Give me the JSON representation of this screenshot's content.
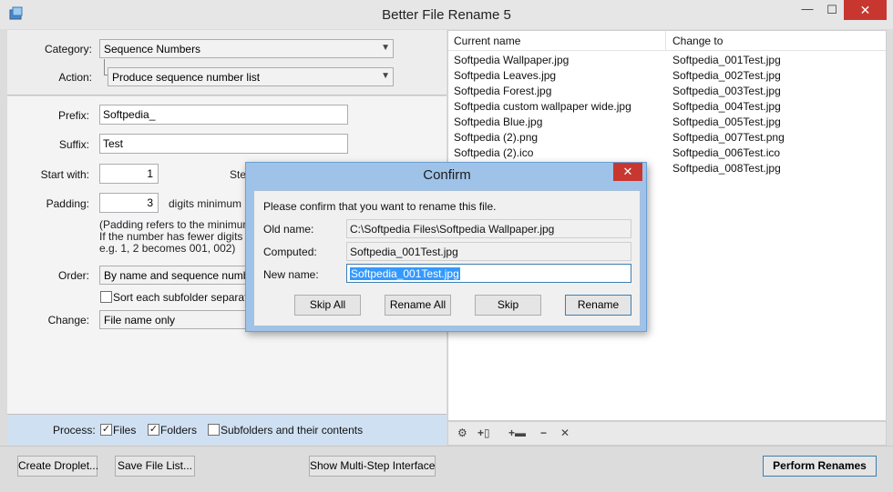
{
  "window": {
    "title": "Better File Rename 5",
    "min_glyph": "—",
    "max_glyph": "☐",
    "close_glyph": "✕"
  },
  "left": {
    "category_label": "Category:",
    "category_value": "Sequence Numbers",
    "action_label": "Action:",
    "action_value": "Produce sequence number list",
    "prefix_label": "Prefix:",
    "prefix_value": "Softpedia_",
    "suffix_label": "Suffix:",
    "suffix_value": "Test",
    "start_label": "Start with:",
    "start_value": "1",
    "step_label": "Ste",
    "padding_label": "Padding:",
    "padding_value": "3",
    "padding_unit": "digits minimum",
    "padding_note_1": "(Padding refers to the minimum nu",
    "padding_note_2": "If the number has fewer digits leac",
    "padding_note_3": "e.g. 1, 2 becomes 001, 002)",
    "order_label": "Order:",
    "order_value": "By name and sequence number (",
    "sort_label": "Sort each subfolder separately",
    "change_label": "Change:",
    "change_value": "File name only"
  },
  "process": {
    "label": "Process:",
    "files_label": "Files",
    "folders_label": "Folders",
    "subfolders_label": "Subfolders and their contents"
  },
  "list": {
    "col_current": "Current name",
    "col_change": "Change to",
    "rows": [
      {
        "current": "Softpedia Wallpaper.jpg",
        "change": "Softpedia_001Test.jpg"
      },
      {
        "current": "Softpedia Leaves.jpg",
        "change": "Softpedia_002Test.jpg"
      },
      {
        "current": "Softpedia Forest.jpg",
        "change": "Softpedia_003Test.jpg"
      },
      {
        "current": "Softpedia custom wallpaper wide.jpg",
        "change": "Softpedia_004Test.jpg"
      },
      {
        "current": "Softpedia Blue.jpg",
        "change": "Softpedia_005Test.jpg"
      },
      {
        "current": "Softpedia (2).png",
        "change": "Softpedia_007Test.png"
      },
      {
        "current": "Softpedia (2).ico",
        "change": "Softpedia_006Test.ico"
      },
      {
        "current": "",
        "change": "Softpedia_008Test.jpg"
      }
    ]
  },
  "toolbar": {
    "settings_icon": "⚙",
    "add_file_icon": "+▯",
    "add_folder_icon": "+▬",
    "remove_icon": "−",
    "clear_icon": "✕"
  },
  "dialog": {
    "title": "Confirm",
    "message": "Please confirm that you want to rename this file.",
    "old_label": "Old name:",
    "old_value": "C:\\Softpedia Files\\Softpedia Wallpaper.jpg",
    "computed_label": "Computed:",
    "computed_value": "Softpedia_001Test.jpg",
    "new_label": "New name:",
    "new_value": "Softpedia_001Test.jpg",
    "skip_all": "Skip All",
    "rename_all": "Rename All",
    "skip": "Skip",
    "rename": "Rename"
  },
  "bottom": {
    "create_droplet": "Create Droplet...",
    "save_list": "Save File List...",
    "multi_step": "Show Multi-Step Interface",
    "perform": "Perform Renames"
  }
}
